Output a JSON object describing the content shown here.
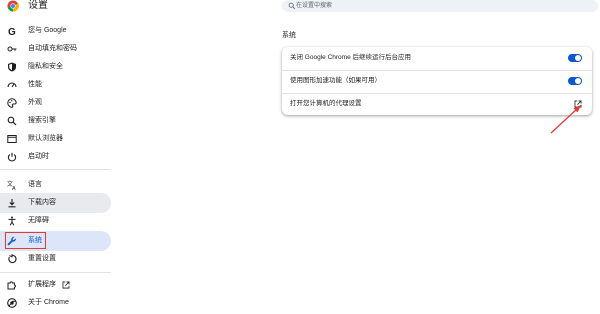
{
  "app": {
    "title": "设置"
  },
  "search": {
    "placeholder": "在设置中搜索"
  },
  "sidebar": {
    "items": [
      {
        "label": "您与 Google"
      },
      {
        "label": "自动填充和密码"
      },
      {
        "label": "隐私和安全"
      },
      {
        "label": "性能"
      },
      {
        "label": "外观"
      },
      {
        "label": "搜索引擎"
      },
      {
        "label": "默认浏览器"
      },
      {
        "label": "启动时"
      },
      {
        "label": "语言"
      },
      {
        "label": "下载内容"
      },
      {
        "label": "无障碍"
      },
      {
        "label": "系统"
      },
      {
        "label": "重置设置"
      },
      {
        "label": "扩展程序"
      },
      {
        "label": "关于 Chrome"
      }
    ]
  },
  "main": {
    "section_title": "系统",
    "rows": [
      {
        "label": "关闭 Google Chrome 后继续运行后台应用",
        "toggle": "on"
      },
      {
        "label": "使用图形加速功能（如果可用）",
        "toggle": "on"
      },
      {
        "label": "打开您计算机的代理设置",
        "icon": "open-in-new-icon"
      }
    ]
  },
  "colors": {
    "accent": "#0b57d0",
    "active_bg": "#dde6f8",
    "annotation": "#e53935"
  }
}
